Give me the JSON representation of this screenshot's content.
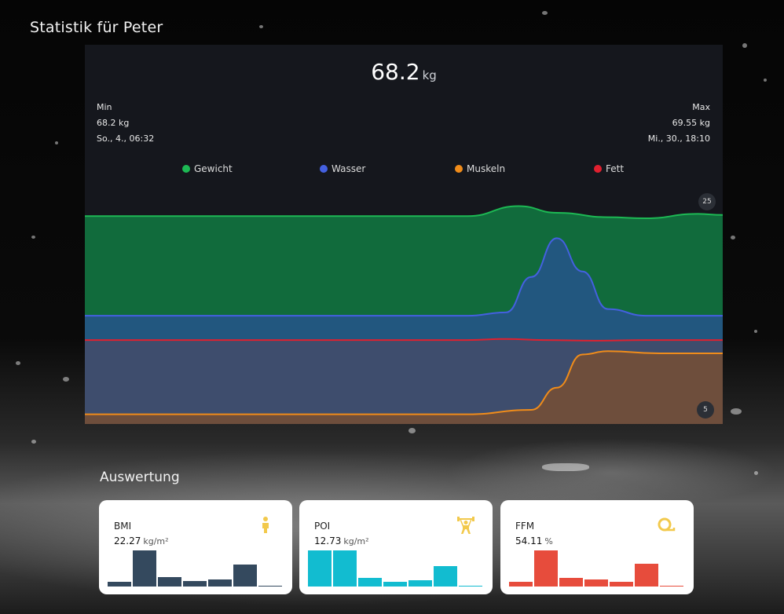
{
  "page": {
    "title": "Statistik für Peter"
  },
  "chart_data": {
    "type": "area",
    "current": {
      "value": "68.2",
      "unit": "kg"
    },
    "min": {
      "label": "Min",
      "value": "68.2 kg",
      "date": "So., 4., 06:32"
    },
    "max": {
      "label": "Max",
      "value": "69.55 kg",
      "date": "Mi., 30., 18:10"
    },
    "axis_badges": {
      "top": "25",
      "bottom": "5"
    },
    "series": [
      {
        "name": "Gewicht",
        "color": "#1db954",
        "x": [
          0,
          0.2,
          0.4,
          0.6,
          0.68,
          0.74,
          0.82,
          0.88,
          0.96,
          1.0
        ],
        "y": [
          23.0,
          23.0,
          23.0,
          23.0,
          23.9,
          23.3,
          22.9,
          22.8,
          23.2,
          23.1
        ]
      },
      {
        "name": "Wasser",
        "color": "#4460e0",
        "x": [
          0,
          0.2,
          0.4,
          0.6,
          0.66,
          0.7,
          0.74,
          0.78,
          0.82,
          0.88,
          1.0
        ],
        "y": [
          14.0,
          14.0,
          14.0,
          14.0,
          14.3,
          17.5,
          21.0,
          18.0,
          14.6,
          14.0,
          14.0
        ]
      },
      {
        "name": "Muskeln",
        "color": "#f08c1a",
        "x": [
          0,
          0.2,
          0.4,
          0.6,
          0.7,
          0.74,
          0.78,
          0.82,
          0.9,
          1.0
        ],
        "y": [
          5.1,
          5.1,
          5.1,
          5.1,
          5.5,
          7.5,
          10.5,
          10.8,
          10.6,
          10.6
        ]
      },
      {
        "name": "Fett",
        "color": "#e0202f",
        "x": [
          0,
          0.2,
          0.4,
          0.6,
          0.66,
          0.72,
          0.8,
          0.88,
          1.0
        ],
        "y": [
          11.8,
          11.8,
          11.8,
          11.8,
          11.9,
          11.8,
          11.75,
          11.8,
          11.8
        ]
      }
    ]
  },
  "evaluation": {
    "title": "Auswertung",
    "cards": [
      {
        "label": "BMI",
        "value": "22.27",
        "unit": "kg/m²",
        "color": "#34495e",
        "icon": "person-icon",
        "bars": [
          0.12,
          1.0,
          0.26,
          0.15,
          0.19,
          0.6,
          0.02
        ]
      },
      {
        "label": "POI",
        "value": "12.73",
        "unit": "kg/m²",
        "color": "#12bcd0",
        "icon": "weightlifter-icon",
        "bars": [
          1.0,
          1.0,
          0.24,
          0.13,
          0.17,
          0.56,
          0.02
        ]
      },
      {
        "label": "FFM",
        "value": "54.11",
        "unit": "%",
        "color": "#e74c3c",
        "icon": "tape-measure-icon",
        "bars": [
          0.13,
          1.0,
          0.24,
          0.2,
          0.12,
          0.63,
          0.02
        ]
      }
    ]
  }
}
